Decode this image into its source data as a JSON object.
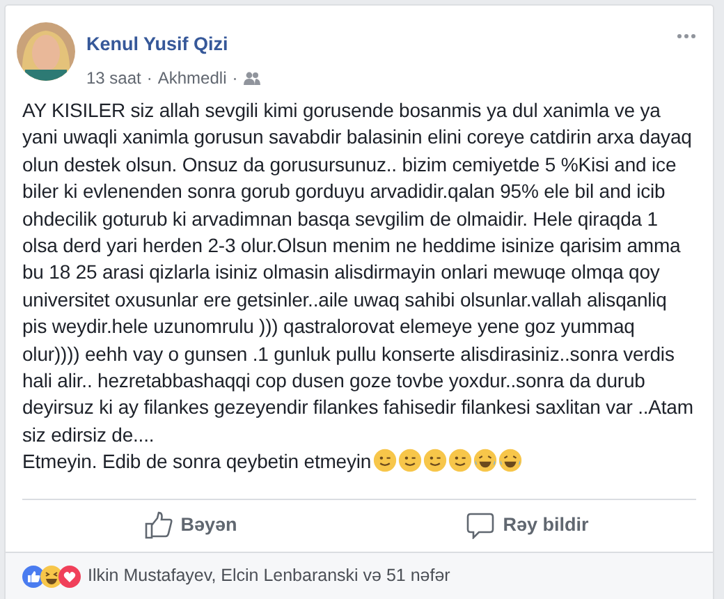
{
  "post": {
    "author": "Kenul Yusif Qizi",
    "time": "13 saat",
    "location": "Akhmedli",
    "separator": "·",
    "audience": {
      "kind": "friends"
    },
    "lines": [
      "AY KISILER siz allah sevgili kimi gorusende bosanmis ya dul xanimla ve ya",
      "yani uwaqli xanimla gorusun savabdir balasinin elini coreye catdirin arxa dayaq",
      "olun destek olsun. Onsuz da gorusursunuz.. bizim cemiyetde 5 %Kisi and ice",
      "biler ki evlenenden sonra gorub gorduyu arvadidir.qalan 95% ele bil and icib",
      "ohdecilik goturub ki arvadimnan basqa sevgilim de olmaidir. Hele qiraqda 1",
      "olsa derd yari herden 2-3 olur.Olsun menim ne heddime isinize qarisim amma",
      "bu 18 25 arasi qizlarla isiniz olmasin alisdirmayin onlari mewuqe olmqa qoy",
      "universitet oxusunlar ere getsinler..aile uwaq sahibi olsunlar.vallah alisqanliq",
      "pis weydir.hele uzunomrulu ))) qastralorovat elemeye yene goz yummaq",
      "olur)))) eehh vay o gunsen .1 gunluk pullu konserte alisdirasiniz..sonra verdis",
      "hali alir.. hezretabbashaqqi cop dusen goze tovbe yoxdur..sonra da durub",
      "deyirsuz ki ay filankes gezeyendir filankes fahisedir filankesi saxlitan var ..Atam",
      "siz edirsiz de...."
    ],
    "last_line": "Etmeyin. Edib de sonra qeybetin etmeyin",
    "emojis": [
      {
        "kind": "wink"
      },
      {
        "kind": "wink"
      },
      {
        "kind": "wink"
      },
      {
        "kind": "wink"
      },
      {
        "kind": "laugh"
      },
      {
        "kind": "laugh"
      }
    ]
  },
  "actions": [
    {
      "kind": "like",
      "label": "Bəyən"
    },
    {
      "kind": "comment",
      "label": "Rəy bildir"
    }
  ],
  "reactions": {
    "icons": [
      {
        "kind": "like"
      },
      {
        "kind": "haha"
      },
      {
        "kind": "love"
      }
    ],
    "summary": "Ilkin Mustafayev, Elcin Lenbaranski və 51 nəfər"
  }
}
